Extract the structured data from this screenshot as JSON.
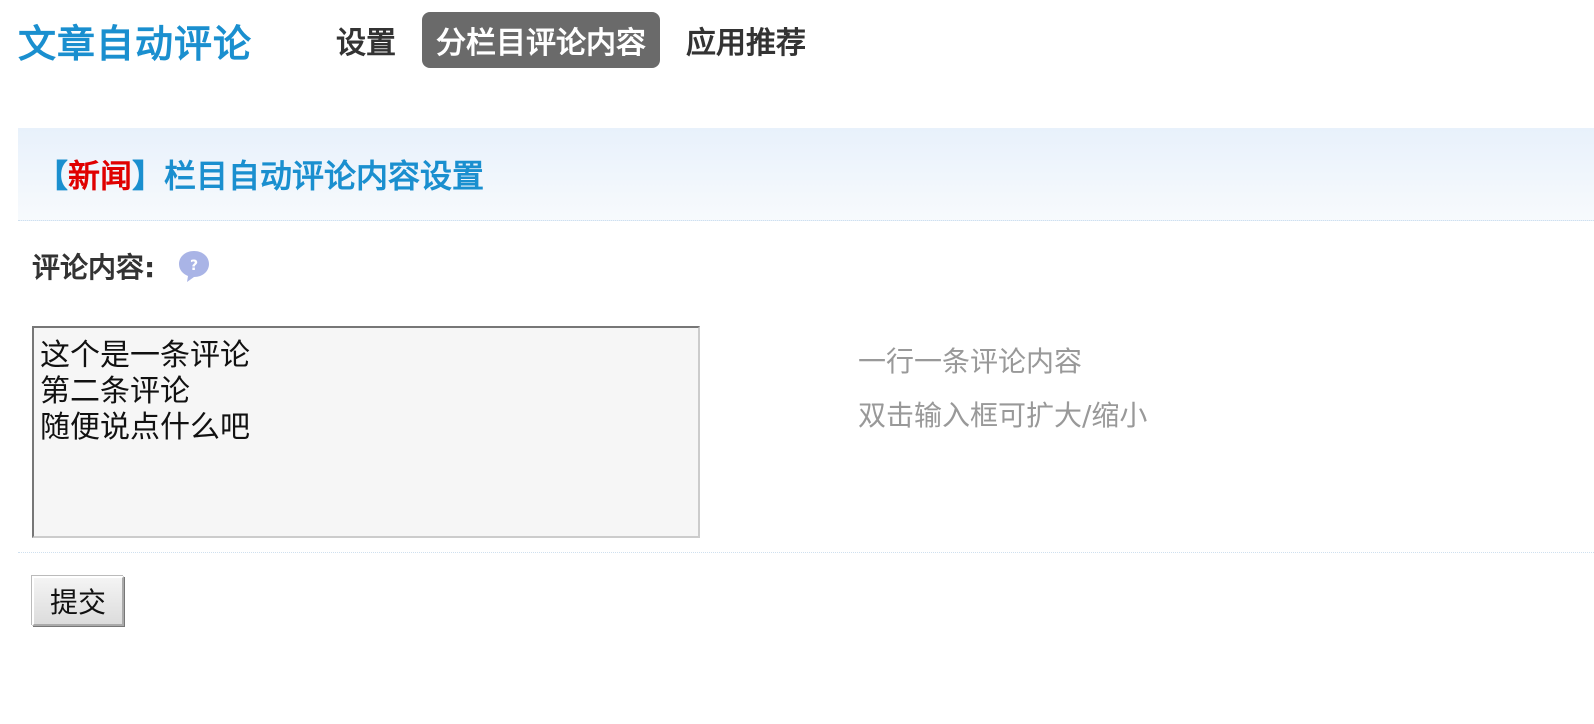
{
  "header": {
    "app_title": "文章自动评论",
    "tabs": [
      {
        "label": "设置",
        "active": false
      },
      {
        "label": "分栏目评论内容",
        "active": true
      },
      {
        "label": "应用推荐",
        "active": false
      }
    ]
  },
  "section": {
    "bracket_open": "【",
    "category": "新闻",
    "bracket_close": "】",
    "title": "栏目自动评论内容设置"
  },
  "form": {
    "comment_label": "评论内容:",
    "help_icon": "help-bubble-icon",
    "comment_value": "这个是一条评论\n第二条评论\n随便说点什么吧",
    "hints": [
      "一行一条评论内容",
      "双击输入框可扩大/缩小"
    ],
    "submit_label": "提交"
  },
  "colors": {
    "accent": "#1a8fcf",
    "category_red": "#e00000",
    "active_tab_bg": "#6a6a6a",
    "hint_gray": "#999999"
  }
}
